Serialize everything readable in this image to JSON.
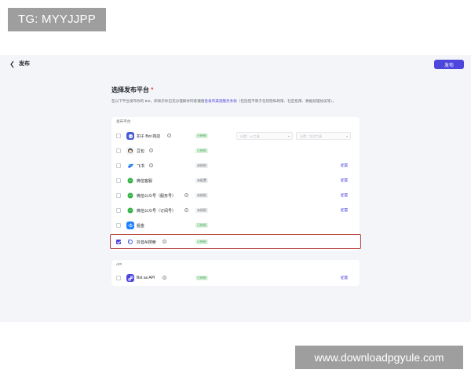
{
  "watermarks": {
    "top": "TG: MYYJJPP",
    "bottom": "www.downloadpgyule.com"
  },
  "header": {
    "title": "发布",
    "publish_label": "发布"
  },
  "section": {
    "title": "选择发布平台",
    "required_mark": "*",
    "desc_prefix": "在以下平台发布你的 Bot，即表示你已充分理解并同意遵循",
    "desc_link": "各发布渠道服务条款",
    "desc_suffix": "（包括但不限于任何隐私政策、社区指南、数据处理协议等）。"
  },
  "groups": [
    {
      "label": "发布平台",
      "rows": [
        {
          "name": "扣子 Bot 商店",
          "status": "已授权",
          "status_ok": true,
          "checked": false,
          "icon_color": "#4a5dd6",
          "select1": "分类：AI 工具",
          "select2": "分类：生活工具",
          "config": ""
        },
        {
          "name": "豆包",
          "status": "已授权",
          "status_ok": true,
          "checked": false,
          "icon_color": "#f2f3f5",
          "config": ""
        },
        {
          "name": "飞书",
          "status": "未授权",
          "status_ok": false,
          "checked": false,
          "icon_color": "#3370ff",
          "config": "配置"
        },
        {
          "name": "微信客服",
          "status": "未配置",
          "status_ok": false,
          "checked": false,
          "icon_color": "#33b348",
          "config": "配置"
        },
        {
          "name": "微信公众号（服务号）",
          "status": "未授权",
          "status_ok": false,
          "checked": false,
          "icon_color": "#33b348",
          "config": "配置"
        },
        {
          "name": "微信公众号（订阅号）",
          "status": "未授权",
          "status_ok": false,
          "checked": false,
          "icon_color": "#33b348",
          "config": "配置"
        },
        {
          "name": "掘金",
          "status": "已授权",
          "status_ok": true,
          "checked": false,
          "icon_color": "#1e80ff",
          "config": ""
        },
        {
          "name": "抖音AI搜索",
          "status": "已授权",
          "status_ok": true,
          "checked": true,
          "icon_color": "#ffffff",
          "config": ""
        }
      ]
    },
    {
      "label": "API",
      "rows": [
        {
          "name": "Bot as API",
          "status": "已授权",
          "status_ok": true,
          "checked": false,
          "icon_color": "#4e46dc",
          "config": "配置"
        }
      ]
    }
  ]
}
